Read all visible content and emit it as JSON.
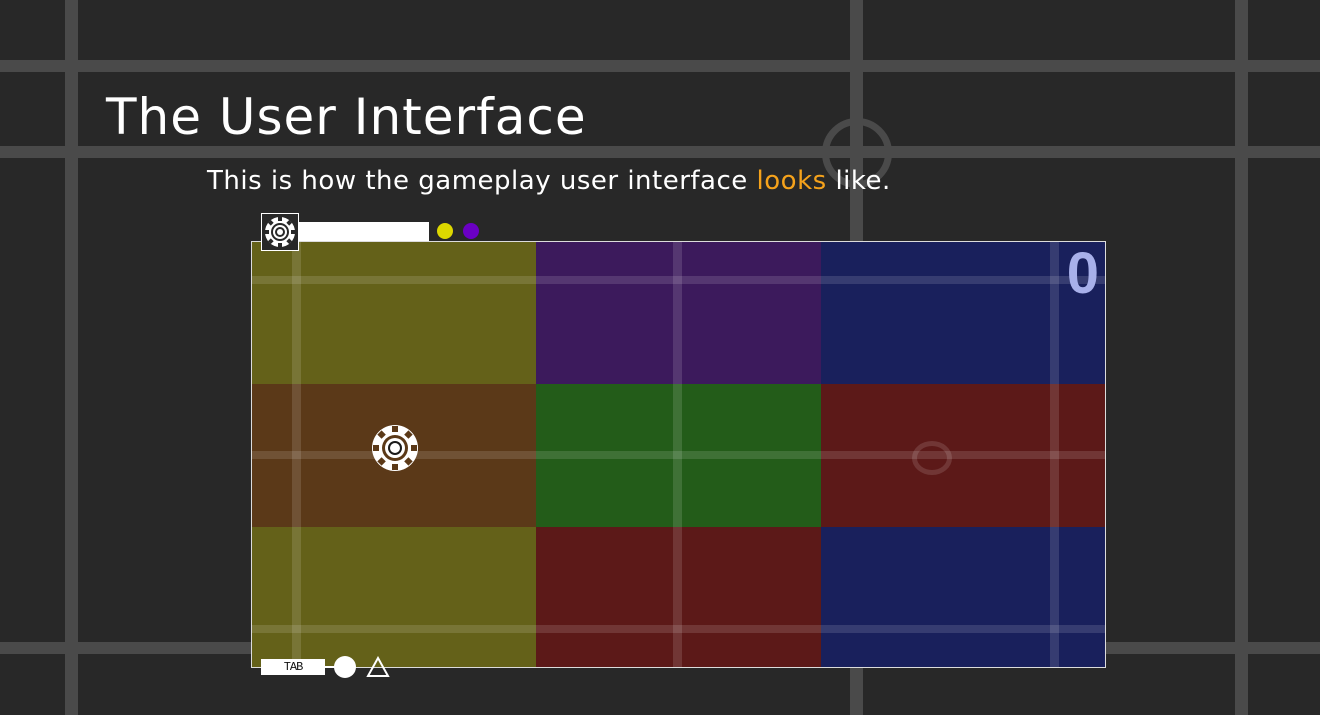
{
  "slide": {
    "title": "The User Interface",
    "subtitle_before": "This is how the gameplay user interface ",
    "subtitle_highlight": "looks",
    "subtitle_after": " like."
  },
  "colors": {
    "background": "#282828",
    "highlight": "#f5a21b",
    "hud_dot_yellow": "#ddd800",
    "hud_dot_purple": "#6a00c4"
  },
  "hud": {
    "top": {
      "icon": "gear-ring-icon",
      "bar_fill": 1.0,
      "dots": [
        "yellow",
        "purple"
      ]
    },
    "bottom": {
      "tab_label": "TAB",
      "shapes": [
        "circle",
        "triangle"
      ]
    }
  },
  "game": {
    "score": "0",
    "player_tile": 3,
    "tiles": [
      {
        "name": "olive",
        "color": "#646119"
      },
      {
        "name": "purple",
        "color": "#3c1a5c"
      },
      {
        "name": "navy",
        "color": "#19205c"
      },
      {
        "name": "brown",
        "color": "#5b3918"
      },
      {
        "name": "green",
        "color": "#235c19"
      },
      {
        "name": "red",
        "color": "#5c1918"
      },
      {
        "name": "olive",
        "color": "#646119"
      },
      {
        "name": "red",
        "color": "#5c1918"
      },
      {
        "name": "navy",
        "color": "#19205c"
      }
    ]
  }
}
